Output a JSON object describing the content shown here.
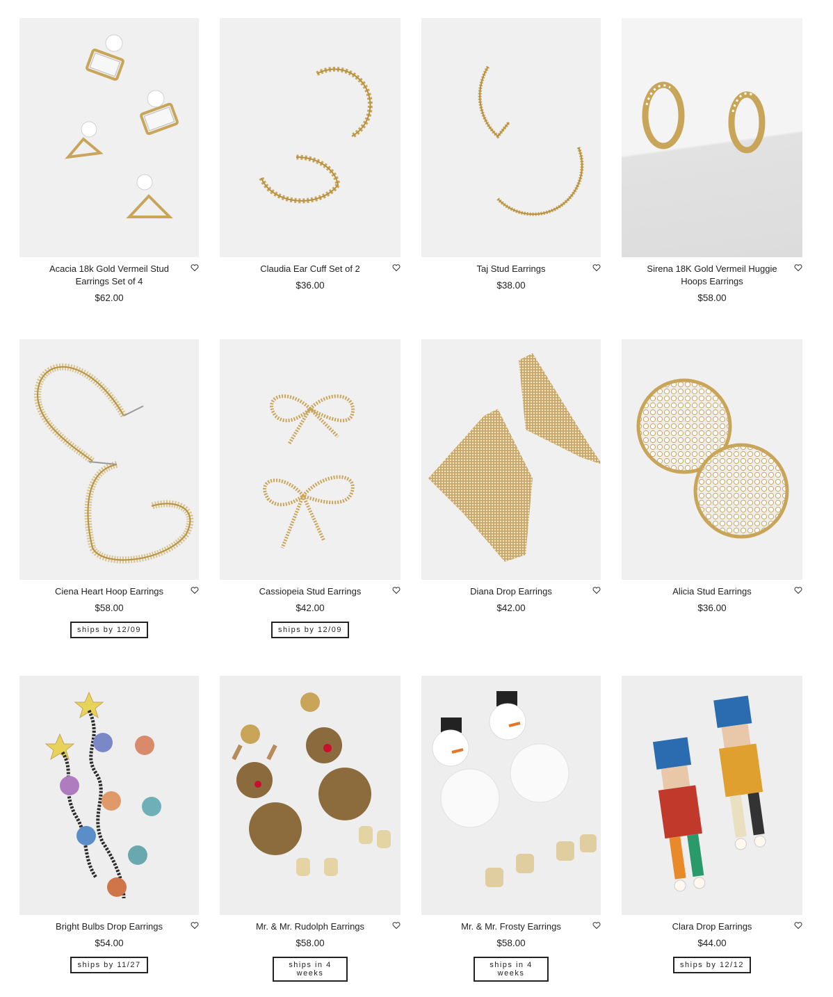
{
  "products": [
    {
      "name": "Acacia 18k Gold Vermeil Stud Earrings Set of 4",
      "price": "$62.00",
      "ship": null,
      "icon": "heart-icon"
    },
    {
      "name": "Claudia Ear Cuff Set of 2",
      "price": "$36.00",
      "ship": null,
      "icon": "heart-icon"
    },
    {
      "name": "Taj Stud Earrings",
      "price": "$38.00",
      "ship": null,
      "icon": "heart-icon"
    },
    {
      "name": "Sirena 18K Gold Vermeil Huggie Hoops Earrings",
      "price": "$58.00",
      "ship": null,
      "icon": "heart-icon"
    },
    {
      "name": "Ciena Heart Hoop Earrings",
      "price": "$58.00",
      "ship": "ships by 12/09",
      "icon": "heart-icon"
    },
    {
      "name": "Cassiopeia Stud Earrings",
      "price": "$42.00",
      "ship": "ships by 12/09",
      "icon": "heart-icon"
    },
    {
      "name": "Diana Drop Earrings",
      "price": "$42.00",
      "ship": null,
      "icon": "heart-icon"
    },
    {
      "name": "Alicia Stud Earrings",
      "price": "$36.00",
      "ship": null,
      "icon": "heart-icon"
    },
    {
      "name": "Bright Bulbs Drop Earrings",
      "price": "$54.00",
      "ship": "ships by 11/27",
      "icon": "heart-icon"
    },
    {
      "name": "Mr. & Mr. Rudolph Earrings",
      "price": "$58.00",
      "ship": "ships in 4 weeks",
      "icon": "heart-icon"
    },
    {
      "name": "Mr. & Mr. Frosty Earrings",
      "price": "$58.00",
      "ship": "ships in 4 weeks",
      "icon": "heart-icon"
    },
    {
      "name": "Clara Drop Earrings",
      "price": "$44.00",
      "ship": "ships by 12/12",
      "icon": "heart-icon"
    }
  ],
  "colors": {
    "thumb_background": "#eeeeee",
    "gold": "#c9a55a",
    "text": "#222222"
  }
}
